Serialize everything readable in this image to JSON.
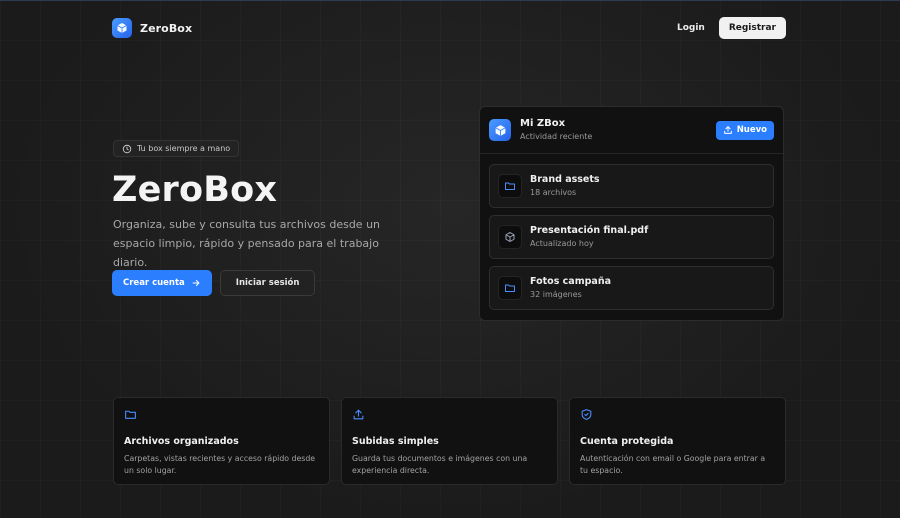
{
  "header": {
    "brand": "ZeroBox",
    "login": "Login",
    "register": "Registrar"
  },
  "hero": {
    "badge": "Tu box siempre a mano",
    "title": "ZeroBox",
    "subtitle": "Organiza, sube y consulta tus archivos desde un espacio limpio, rápido y pensado para el trabajo diario.",
    "primary_cta": "Crear cuenta",
    "secondary_cta": "Iniciar sesión"
  },
  "dashboard": {
    "title": "Mi ZBox",
    "subtitle": "Actividad reciente",
    "new_button": "Nuevo",
    "items": [
      {
        "icon": "folder-icon",
        "name": "Brand assets",
        "meta": "18 archivos"
      },
      {
        "icon": "cube-icon",
        "name": "Presentación final.pdf",
        "meta": "Actualizado hoy"
      },
      {
        "icon": "folder-icon",
        "name": "Fotos campaña",
        "meta": "32 imágenes"
      }
    ]
  },
  "features": [
    {
      "icon": "folder-icon",
      "title": "Archivos organizados",
      "desc": "Carpetas, vistas recientes y acceso rápido desde un solo lugar."
    },
    {
      "icon": "upload-icon",
      "title": "Subidas simples",
      "desc": "Guarda tus documentos e imágenes con una experiencia directa."
    },
    {
      "icon": "shield-icon",
      "title": "Cuenta protegida",
      "desc": "Autenticación con email o Google para entrar a tu espacio."
    }
  ],
  "colors": {
    "accent": "#2b7fff",
    "background": "#1b1b1b",
    "card": "#111111"
  }
}
